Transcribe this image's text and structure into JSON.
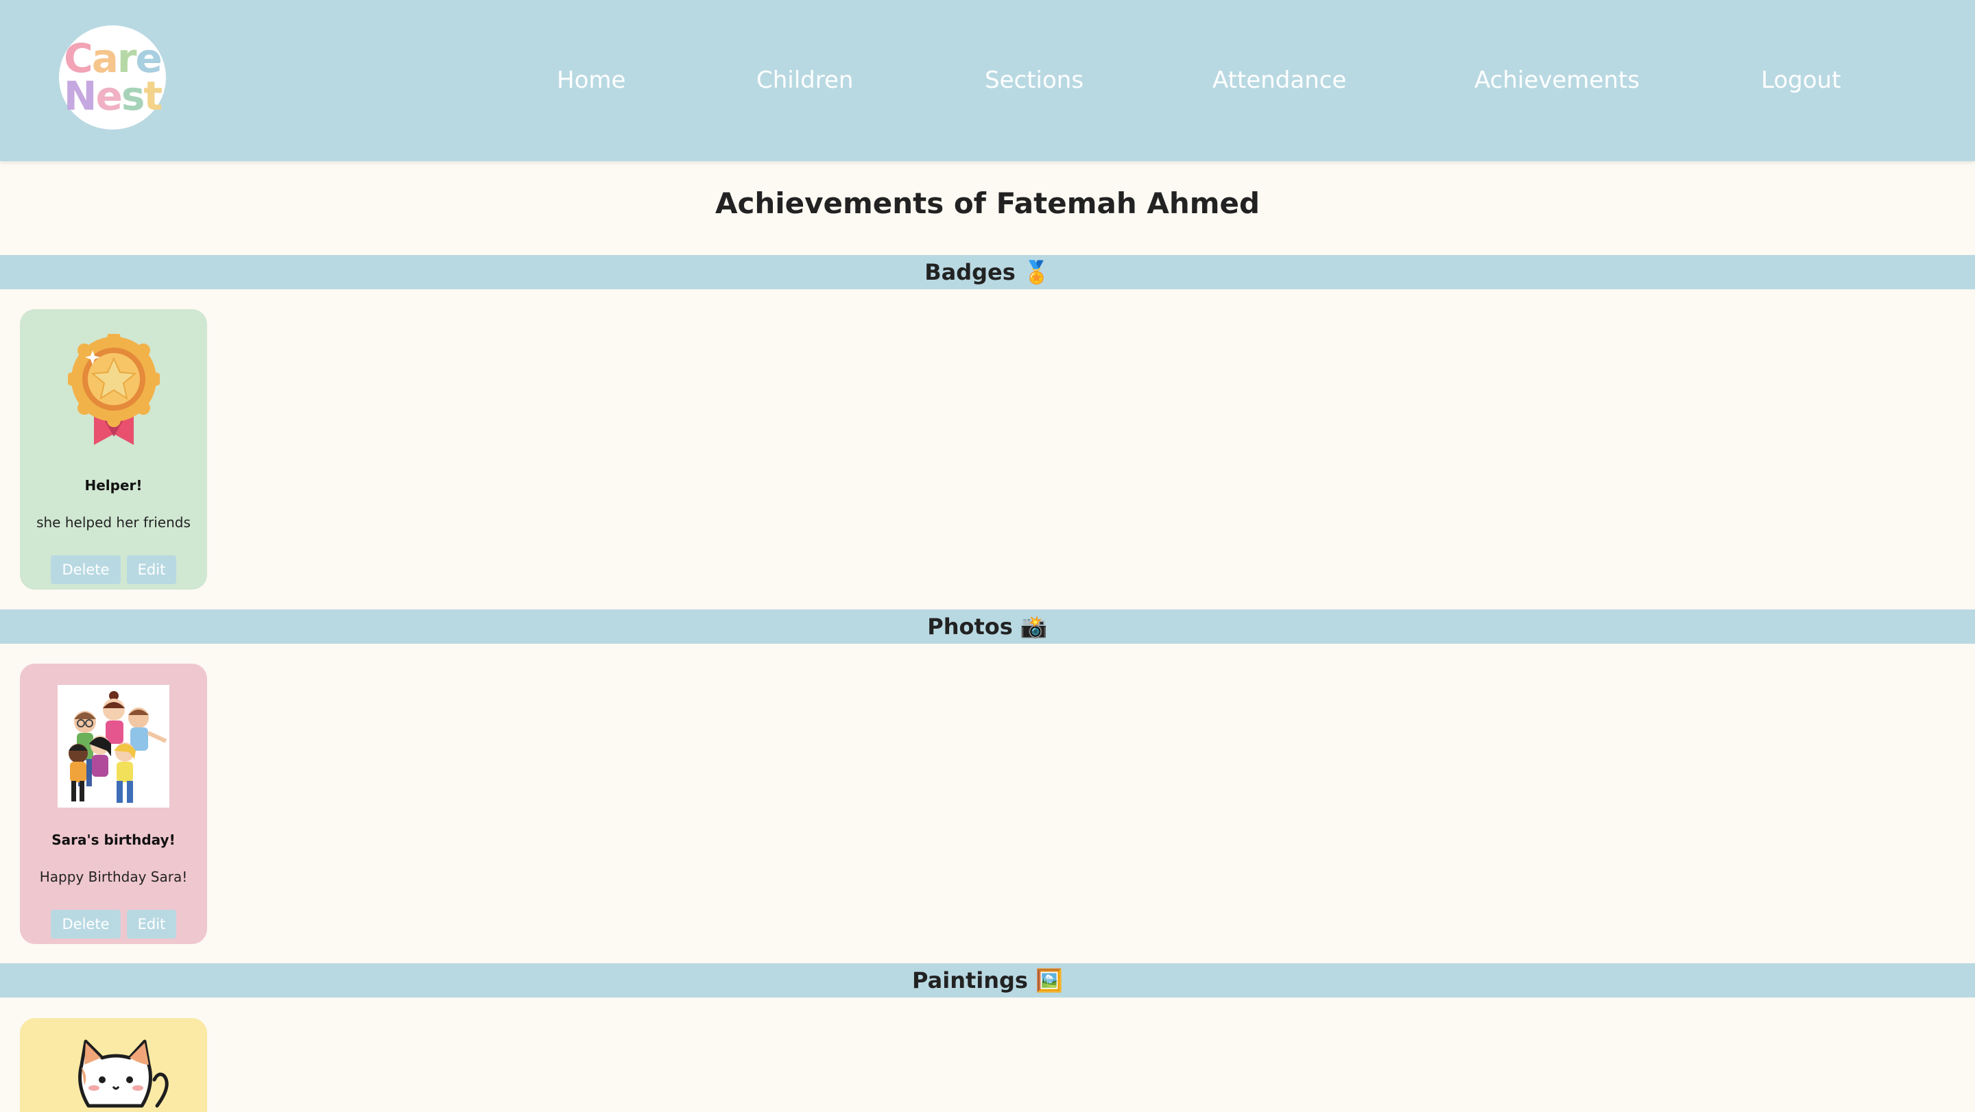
{
  "brand": {
    "logo_line1": "Care",
    "logo_line2": "Nest"
  },
  "nav": {
    "items": [
      {
        "label": "Home"
      },
      {
        "label": "Children"
      },
      {
        "label": "Sections"
      },
      {
        "label": "Attendance"
      },
      {
        "label": "Achievements"
      },
      {
        "label": "Logout"
      }
    ]
  },
  "page": {
    "title": "Achievements of Fatemah Ahmed"
  },
  "sections": {
    "badges": {
      "heading": "Badges 🏅",
      "cards": [
        {
          "title": "Helper!",
          "description": "she helped her friends",
          "delete_label": "Delete",
          "edit_label": "Edit",
          "image": "medal-icon"
        }
      ]
    },
    "photos": {
      "heading": "Photos 📸",
      "cards": [
        {
          "title": "Sara's birthday!",
          "description": "Happy Birthday Sara!",
          "delete_label": "Delete",
          "edit_label": "Edit",
          "image": "kids-group-photo"
        }
      ]
    },
    "paintings": {
      "heading": "Paintings 🖼️",
      "cards": [
        {
          "image": "cat-painting"
        }
      ]
    }
  },
  "colors": {
    "navbar": "#b9d9e2",
    "page_background": "#fdf9f3",
    "badge_card": "#d0e7d2",
    "photo_card": "#efc7cf",
    "painting_card": "#fbeaa6",
    "button": "#b9d9e2"
  }
}
